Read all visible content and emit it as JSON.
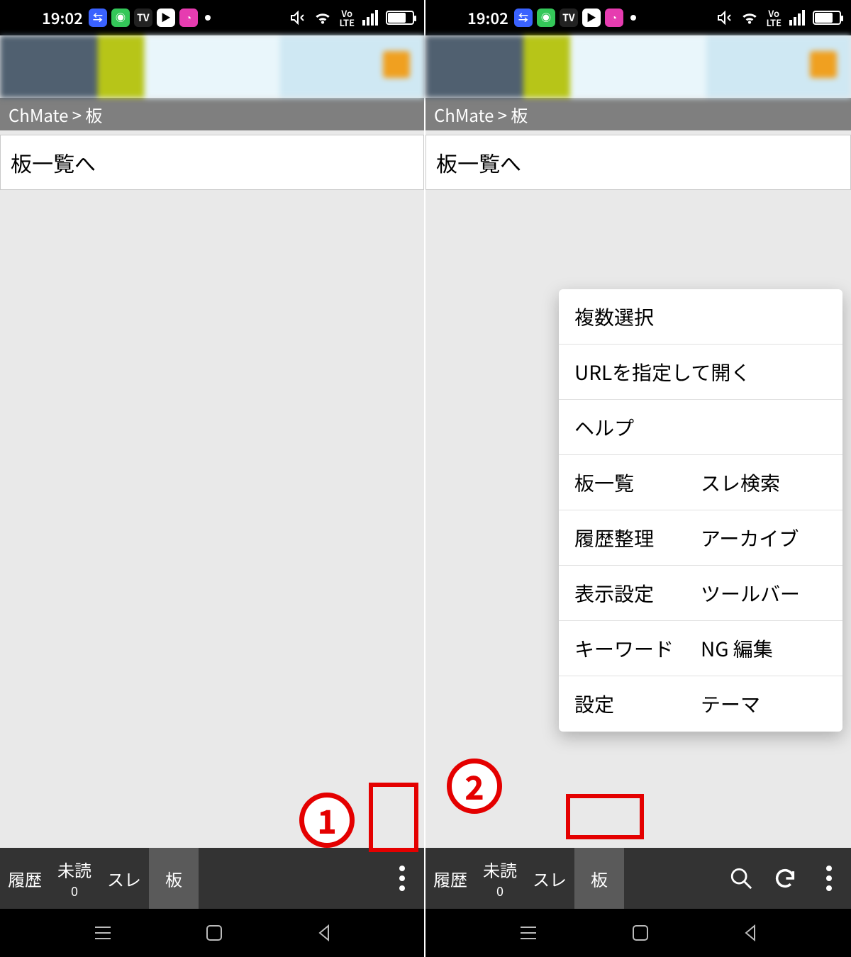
{
  "status": {
    "time": "19:02",
    "tv_label": "TV",
    "net_label": "Vo",
    "lte_label": "LTE"
  },
  "breadcrumb": "ChMate > 板",
  "main_link": "板一覧へ",
  "tabs": {
    "history": "履歴",
    "unread": "未読",
    "unread_count": "0",
    "thread": "スレ",
    "board": "板"
  },
  "menu": {
    "multi_select": "複数選択",
    "open_url": "URLを指定して開く",
    "help": "ヘルプ",
    "board_list": "板一覧",
    "thread_search": "スレ検索",
    "history_cleanup": "履歴整理",
    "archive": "アーカイブ",
    "display_settings": "表示設定",
    "toolbar": "ツールバー",
    "keyword": "キーワード",
    "ng_edit": "NG 編集",
    "settings": "設定",
    "theme": "テーマ"
  },
  "annotations": {
    "one": "1",
    "two": "2"
  }
}
